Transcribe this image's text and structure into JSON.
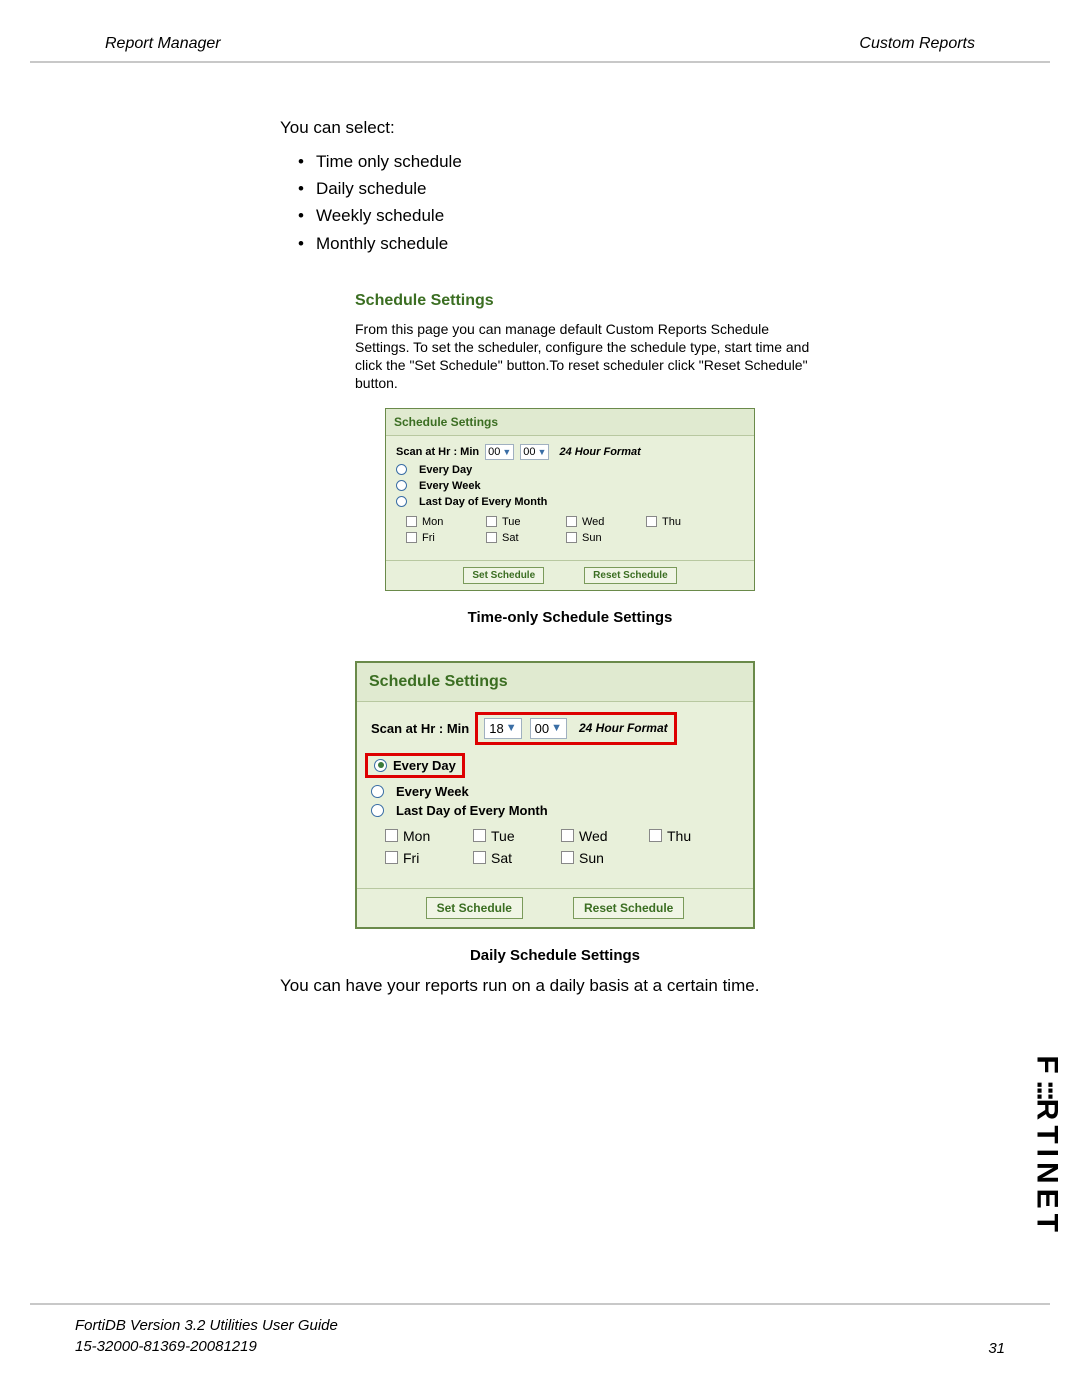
{
  "header": {
    "left": "Report Manager",
    "right": "Custom Reports"
  },
  "intro": "You can select:",
  "schedule_types": [
    "Time only schedule",
    "Daily schedule",
    "Weekly schedule",
    "Monthly schedule"
  ],
  "section": {
    "title": "Schedule Settings",
    "description": "From this page you can manage default Custom Reports Schedule Settings. To set the scheduler, configure the schedule type, start time and click the \"Set Schedule\" button.To reset scheduler click \"Reset Schedule\" button."
  },
  "panel_small": {
    "header": "Schedule Settings",
    "scan_label": "Scan at Hr : Min",
    "hour": "00",
    "minute": "00",
    "format_label": "24 Hour Format",
    "freq": {
      "every_day": "Every Day",
      "every_week": "Every Week",
      "last_day": "Last Day of Every Month"
    },
    "days": [
      "Mon",
      "Tue",
      "Wed",
      "Thu",
      "Fri",
      "Sat",
      "Sun"
    ],
    "set_btn": "Set Schedule",
    "reset_btn": "Reset Schedule"
  },
  "caption_small": "Time-only Schedule Settings",
  "panel_large": {
    "header": "Schedule Settings",
    "scan_label": "Scan at Hr : Min",
    "hour": "18",
    "minute": "00",
    "format_label": "24 Hour Format",
    "freq": {
      "every_day": "Every Day",
      "every_week": "Every Week",
      "last_day": "Last Day of Every Month"
    },
    "days": [
      "Mon",
      "Tue",
      "Wed",
      "Thu",
      "Fri",
      "Sat",
      "Sun"
    ],
    "set_btn": "Set Schedule",
    "reset_btn": "Reset Schedule"
  },
  "caption_large": "Daily Schedule Settings",
  "body_after": "You can have your reports run on a daily basis at a certain time.",
  "footer": {
    "line1": "FortiDB Version 3.2 Utilities  User Guide",
    "line2": "15-32000-81369-20081219",
    "page": "31"
  },
  "brand": {
    "pre": "F",
    "post": "RTINET"
  }
}
